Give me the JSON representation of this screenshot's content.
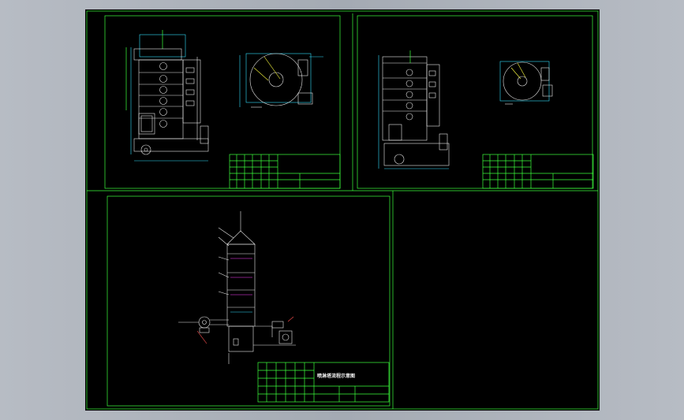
{
  "colors": {
    "background": "#000000",
    "frame": "#3cff3c",
    "line": "#e8e8e8",
    "dimension": "#33e0ff",
    "workspace": "#a9aeb6"
  },
  "sheets": [
    {
      "id": "sheet-1",
      "title": "",
      "note": ""
    },
    {
      "id": "sheet-2",
      "title": "",
      "note": ""
    },
    {
      "id": "sheet-3",
      "title": "喷淋塔流程示意图"
    }
  ],
  "callouts": [
    {
      "text": ""
    },
    {
      "text": ""
    },
    {
      "text": ""
    },
    {
      "text": ""
    },
    {
      "text": ""
    },
    {
      "text": ""
    },
    {
      "text": ""
    },
    {
      "text": ""
    },
    {
      "text": ""
    },
    {
      "text": ""
    }
  ]
}
